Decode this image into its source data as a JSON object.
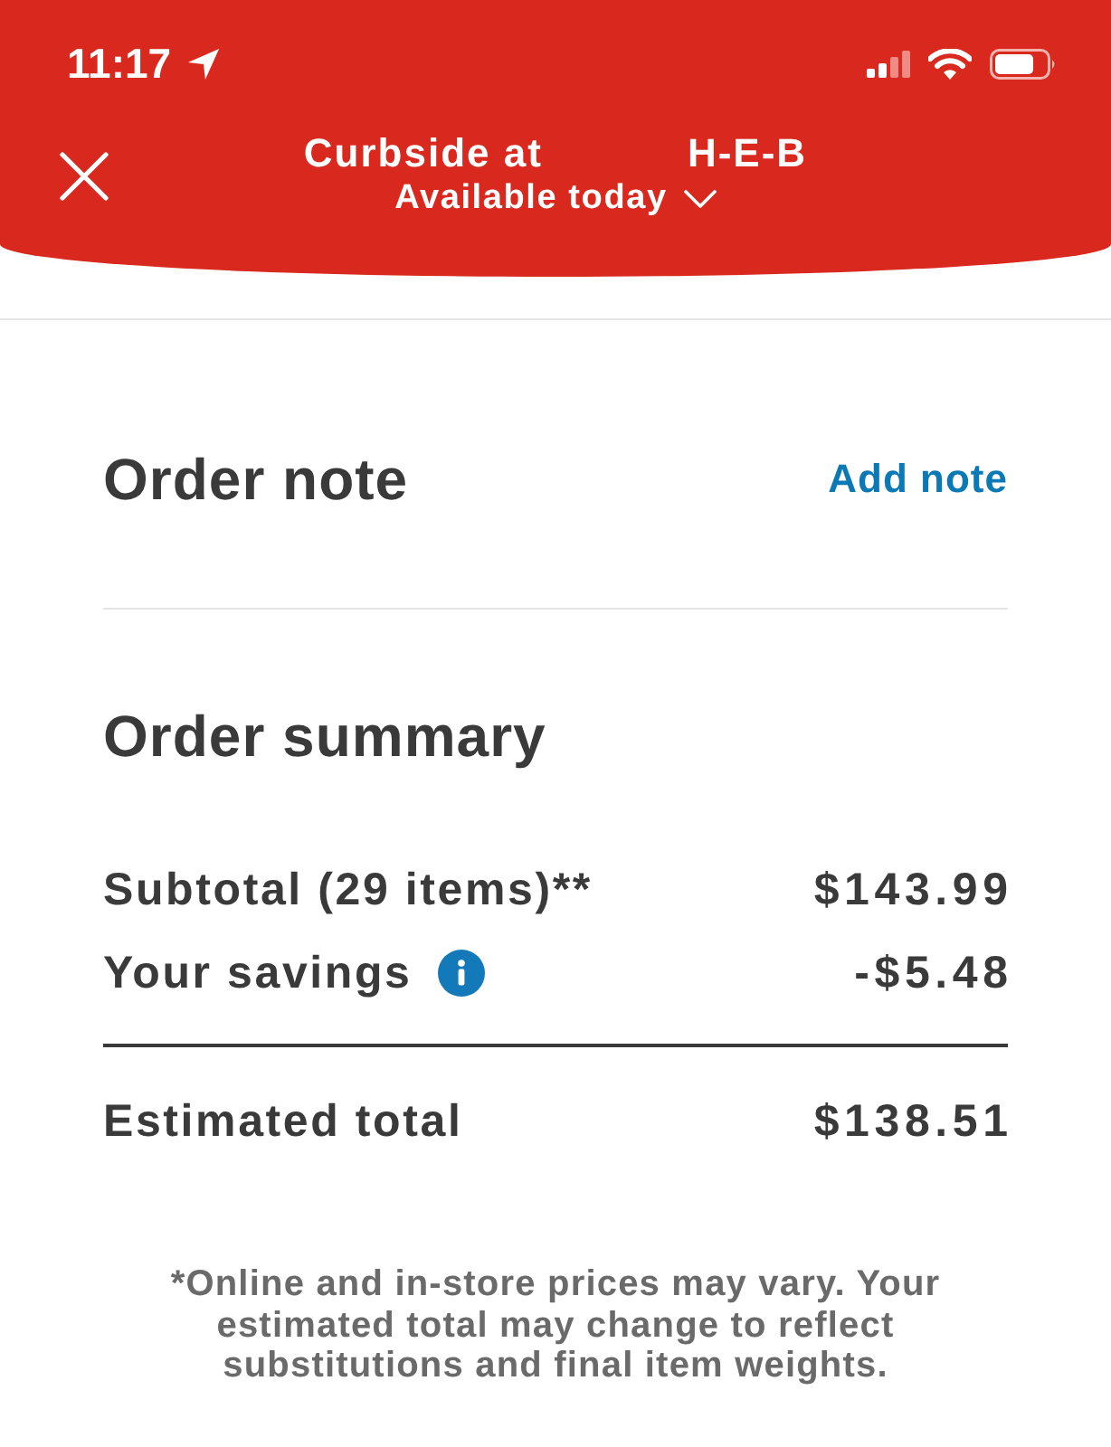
{
  "status_bar": {
    "time": "11:17"
  },
  "header": {
    "title": [
      "Curbside at",
      "H-E-B"
    ],
    "subtitle": "Available today"
  },
  "order_note": {
    "title": "Order note",
    "action": "Add note"
  },
  "order_summary": {
    "title": "Order summary",
    "rows": [
      {
        "label": "Subtotal (29 items)**",
        "value": "$143.99",
        "info": false
      },
      {
        "label": "Your savings",
        "value": "-$5.48",
        "info": true
      }
    ],
    "total": {
      "label": "Estimated total",
      "value": "$138.51"
    }
  },
  "footnote": "*Online and in-store prices may vary. Your estimated total may change to reflect substitutions and final item weights."
}
